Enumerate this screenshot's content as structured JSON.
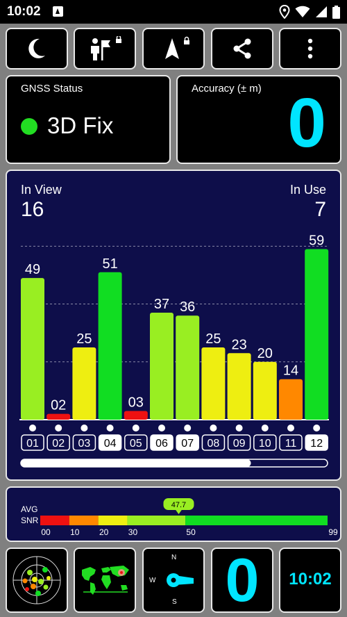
{
  "status_bar": {
    "time": "10:02"
  },
  "toolbar": {
    "icons": [
      "moon-icon",
      "location-person-icon",
      "navigation-arrow-icon",
      "share-icon",
      "more-vert-icon"
    ]
  },
  "gnss_status": {
    "label": "GNSS Status",
    "value": "3D Fix",
    "indicator_color": "#22dd22"
  },
  "accuracy": {
    "label": "Accuracy (± m)",
    "value": "0",
    "value_color": "#00e5ff"
  },
  "satellites": {
    "in_view_label": "In View",
    "in_view_value": "16",
    "in_use_label": "In Use",
    "in_use_value": "7"
  },
  "chart_data": {
    "type": "bar",
    "categories": [
      "01",
      "02",
      "03",
      "04",
      "05",
      "06",
      "07",
      "08",
      "09",
      "10",
      "11",
      "12"
    ],
    "values": [
      49,
      2,
      25,
      51,
      3,
      37,
      36,
      25,
      23,
      20,
      14,
      59
    ],
    "labels": [
      "49",
      "02",
      "25",
      "51",
      "03",
      "37",
      "36",
      "25",
      "23",
      "20",
      "14",
      "59"
    ],
    "colors": [
      "#99ee22",
      "#ee1111",
      "#eeee11",
      "#11dd22",
      "#ee1111",
      "#99ee22",
      "#99ee22",
      "#eeee11",
      "#eeee11",
      "#eeee11",
      "#ff8800",
      "#11dd22"
    ],
    "in_use": [
      false,
      false,
      false,
      true,
      false,
      true,
      true,
      false,
      false,
      false,
      false,
      true
    ],
    "ylim": [
      0,
      62
    ],
    "gridlines": [
      20,
      40,
      60
    ],
    "scroll_fraction": 0.75
  },
  "snr": {
    "label_line1": "AVG",
    "label_line2": "SNR",
    "avg_value": 47.7,
    "avg_label": "47.7",
    "scale_max": 99,
    "ticks": [
      "00",
      "10",
      "20",
      "30",
      "50",
      "99"
    ],
    "tick_values": [
      0,
      10,
      20,
      30,
      50,
      99
    ],
    "segments": [
      {
        "from": 0,
        "to": 10,
        "color": "#ee1111"
      },
      {
        "from": 10,
        "to": 20,
        "color": "#ff8800"
      },
      {
        "from": 20,
        "to": 30,
        "color": "#eeee11"
      },
      {
        "from": 30,
        "to": 50,
        "color": "#99ee22"
      },
      {
        "from": 50,
        "to": 99,
        "color": "#11dd22"
      }
    ]
  },
  "bottom_bar": {
    "compass": {
      "north": "N",
      "south": "S",
      "west": "W"
    },
    "accuracy_value": "0",
    "clock": "10:02",
    "accent_color": "#00e5ff"
  }
}
